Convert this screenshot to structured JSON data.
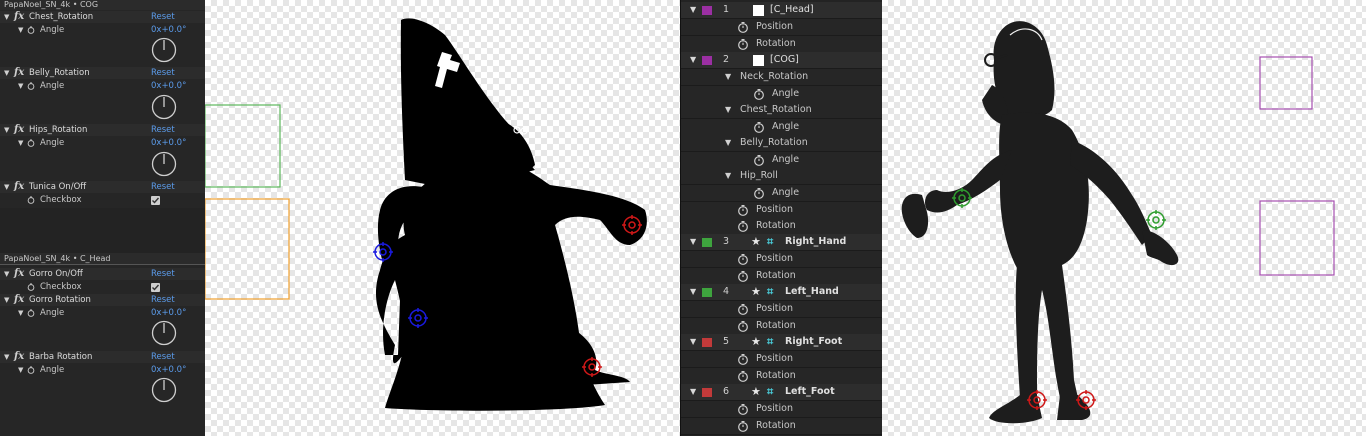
{
  "effect_controls": {
    "title_cog": "PapaNoel_SN_4k • COG",
    "title_head": "PapaNoel_SN_4k • C_Head",
    "reset_label": "Reset",
    "angle_value": "0x+0.0°",
    "effects_cog": [
      {
        "name": "Chest_Rotation",
        "prop": "Angle"
      },
      {
        "name": "Belly_Rotation",
        "prop": "Angle"
      },
      {
        "name": "Hips_Rotation",
        "prop": "Angle"
      },
      {
        "name": "Tunica On/Off",
        "prop": "Checkbox"
      }
    ],
    "effects_head": [
      {
        "name": "Gorro On/Off",
        "prop": "Checkbox"
      },
      {
        "name": "Gorro Rotation",
        "prop": "Angle"
      },
      {
        "name": "Barba Rotation",
        "prop": "Angle"
      }
    ]
  },
  "timeline": {
    "layers": [
      {
        "num": "1",
        "name": "[C_Head]",
        "color": "#9b2fa3",
        "props": [
          "Position",
          "Rotation"
        ]
      },
      {
        "num": "2",
        "name": "[COG]",
        "color": "#9b2fa3",
        "groups": [
          {
            "name": "Neck_Rotation",
            "prop": "Angle"
          },
          {
            "name": "Chest_Rotation",
            "prop": "Angle"
          },
          {
            "name": "Belly_Rotation",
            "prop": "Angle"
          },
          {
            "name": "Hip_Roll",
            "prop": "Angle"
          }
        ],
        "props": [
          "Position",
          "Rotation"
        ]
      },
      {
        "num": "3",
        "name": "Right_Hand",
        "color": "#3ea43e",
        "props": [
          "Position",
          "Rotation"
        ]
      },
      {
        "num": "4",
        "name": "Left_Hand",
        "color": "#3ea43e",
        "props": [
          "Position",
          "Rotation"
        ]
      },
      {
        "num": "5",
        "name": "Right_Foot",
        "color": "#c23a3a",
        "props": [
          "Position",
          "Rotation"
        ]
      },
      {
        "num": "6",
        "name": "Left_Foot",
        "color": "#c23a3a",
        "props": [
          "Position",
          "Rotation"
        ]
      }
    ]
  },
  "colors": {
    "blue_control": "#1a1ae0",
    "red_control": "#d01818",
    "green_control": "#2f9e2f",
    "green_box": "#5cb85c",
    "orange_box": "#f0a030",
    "purple_box": "#a64fb0",
    "reset_blue": "#5b9bea"
  }
}
